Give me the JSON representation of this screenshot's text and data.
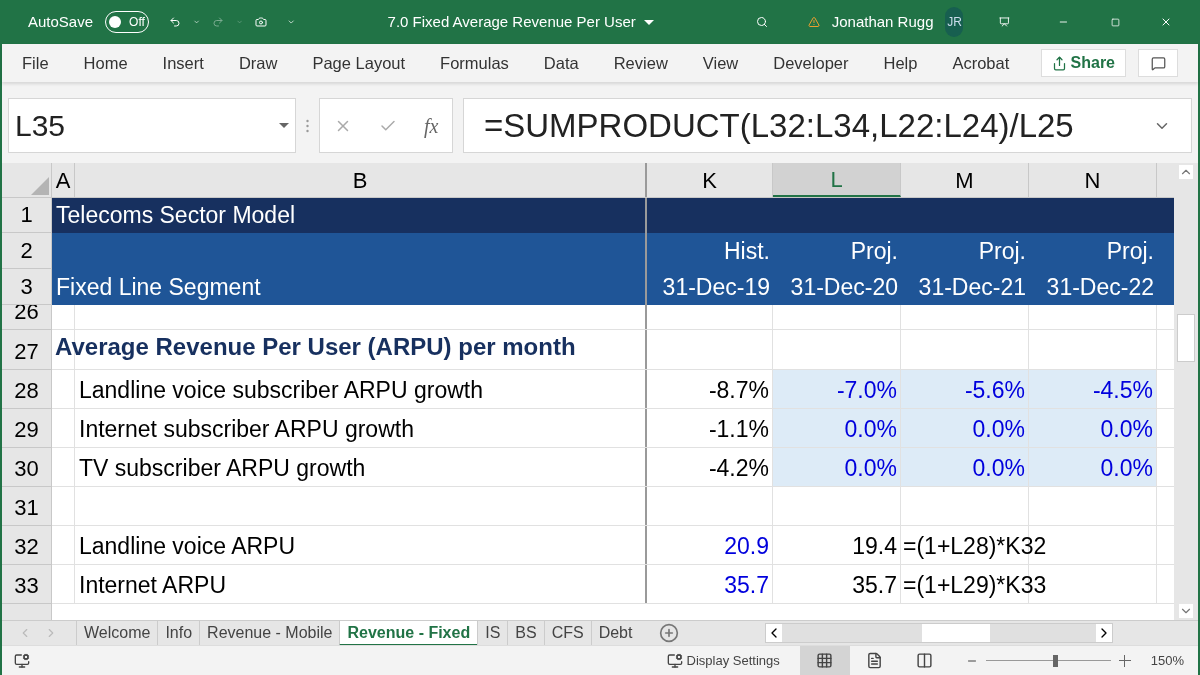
{
  "title_bar": {
    "autosave_label": "AutoSave",
    "autosave_toggle": {
      "label": "Off",
      "on": false
    },
    "document_title": "7.0 Fixed Average Revenue Per User",
    "user_name": "Jonathan Rugg",
    "user_initials": "JR"
  },
  "ribbon_tabs": [
    "File",
    "Home",
    "Insert",
    "Draw",
    "Page Layout",
    "Formulas",
    "Data",
    "Review",
    "View",
    "Developer",
    "Help",
    "Acrobat"
  ],
  "share_button": "Share",
  "formula_bar": {
    "name_box": "L35",
    "function_label": "fx",
    "formula": "=SUMPRODUCT(L32:L34,L22:L24)/L25"
  },
  "columns": [
    {
      "label": "A",
      "selected": false
    },
    {
      "label": "B",
      "selected": false
    },
    {
      "label": "K",
      "selected": false
    },
    {
      "label": "L",
      "selected": true
    },
    {
      "label": "M",
      "selected": false
    },
    {
      "label": "N",
      "selected": false
    }
  ],
  "rows": [
    {
      "number": "1",
      "kind": "title",
      "label": "Telecoms Sector Model",
      "values": []
    },
    {
      "number": "2",
      "kind": "header",
      "values": [
        {
          "text": "Hist."
        },
        {
          "text": "Proj."
        },
        {
          "text": "Proj."
        },
        {
          "text": "Proj."
        }
      ]
    },
    {
      "number": "3",
      "kind": "header",
      "label": "Fixed Line Segment",
      "values": [
        {
          "text": "31-Dec-19"
        },
        {
          "text": "31-Dec-20"
        },
        {
          "text": "31-Dec-21"
        },
        {
          "text": "31-Dec-22"
        }
      ]
    },
    {
      "number": "26",
      "kind": "blank",
      "values": []
    },
    {
      "number": "27",
      "kind": "section",
      "label": "Average Revenue Per User (ARPU) per month",
      "values": []
    },
    {
      "number": "28",
      "kind": "item",
      "label": "Landline voice subscriber ARPU growth",
      "values": [
        {
          "text": "-8.7%",
          "input": false,
          "shaded": false
        },
        {
          "text": "-7.0%",
          "input": true,
          "shaded": true
        },
        {
          "text": "-5.6%",
          "input": true,
          "shaded": true
        },
        {
          "text": "-4.5%",
          "input": true,
          "shaded": true
        }
      ]
    },
    {
      "number": "29",
      "kind": "item",
      "label": "Internet subscriber ARPU growth",
      "values": [
        {
          "text": "-1.1%",
          "input": false,
          "shaded": false
        },
        {
          "text": "0.0%",
          "input": true,
          "shaded": true
        },
        {
          "text": "0.0%",
          "input": true,
          "shaded": true
        },
        {
          "text": "0.0%",
          "input": true,
          "shaded": true
        }
      ]
    },
    {
      "number": "30",
      "kind": "item",
      "label": "TV subscriber ARPU growth",
      "values": [
        {
          "text": "-4.2%",
          "input": false,
          "shaded": false
        },
        {
          "text": "0.0%",
          "input": true,
          "shaded": true
        },
        {
          "text": "0.0%",
          "input": true,
          "shaded": true
        },
        {
          "text": "0.0%",
          "input": true,
          "shaded": true
        }
      ]
    },
    {
      "number": "31",
      "kind": "blank",
      "values": []
    },
    {
      "number": "32",
      "kind": "item",
      "label": "Landline voice ARPU",
      "values": [
        {
          "text": "20.9",
          "input": true,
          "shaded": false
        },
        {
          "text": "19.4",
          "input": false,
          "shaded": false
        },
        {
          "text": "=(1+L28)*K32",
          "kind": "formula"
        }
      ]
    },
    {
      "number": "33",
      "kind": "item",
      "label": "Internet ARPU",
      "values": [
        {
          "text": "35.7",
          "input": true,
          "shaded": false
        },
        {
          "text": "35.7",
          "input": false,
          "shaded": false
        },
        {
          "text": "=(1+L29)*K33",
          "kind": "formula"
        }
      ]
    }
  ],
  "sheet_tabs": [
    {
      "label": "Welcome",
      "selected": false
    },
    {
      "label": "Info",
      "selected": false
    },
    {
      "label": "Revenue - Mobile",
      "selected": false
    },
    {
      "label": "Revenue - Fixed",
      "selected": true
    },
    {
      "label": "IS",
      "selected": false
    },
    {
      "label": "BS",
      "selected": false
    },
    {
      "label": "CFS",
      "selected": false
    },
    {
      "label": "Debt",
      "selected": false
    }
  ],
  "status_bar": {
    "display_settings": "Display Settings",
    "views": [
      {
        "kind": "normal",
        "selected": true
      },
      {
        "kind": "page_layout",
        "selected": false
      },
      {
        "kind": "page_break",
        "selected": false
      }
    ],
    "zoom": {
      "level": 0.55,
      "reading": "150%"
    }
  }
}
